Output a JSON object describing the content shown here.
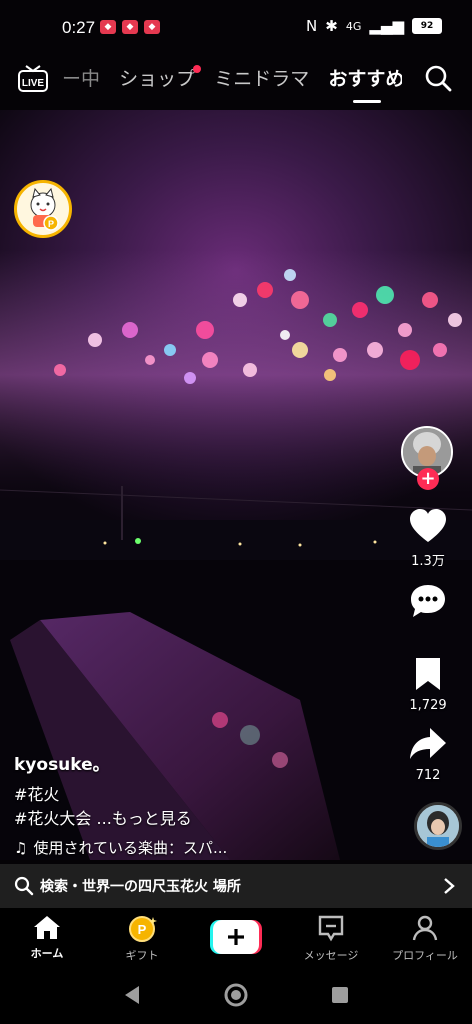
{
  "status": {
    "time": "0:27",
    "network": "4G",
    "battery": "92"
  },
  "nav": {
    "live_label": "LIVE",
    "tabs": [
      {
        "label": "ー中"
      },
      {
        "label": "ショップ"
      },
      {
        "label": "ミニドラマ"
      },
      {
        "label": "おすすめ"
      }
    ]
  },
  "video": {
    "likes": "1.3万",
    "shares_saved": "1,729",
    "shares": "712",
    "username": "kyosuke。",
    "tag1": "#花火",
    "tag2": "#花火大会",
    "more": "...もっと見る",
    "music": "使用されている楽曲：スパ..."
  },
  "search": {
    "label": "検索・世界一の四尺玉花火 場所"
  },
  "bottom": {
    "home": "ホーム",
    "gift": "ギフト",
    "messages": "メッセージ",
    "profile": "プロフィール"
  },
  "colors": {
    "accent": "#fe2c55",
    "cyan": "#25f4ee",
    "gold": "#f6b400"
  }
}
